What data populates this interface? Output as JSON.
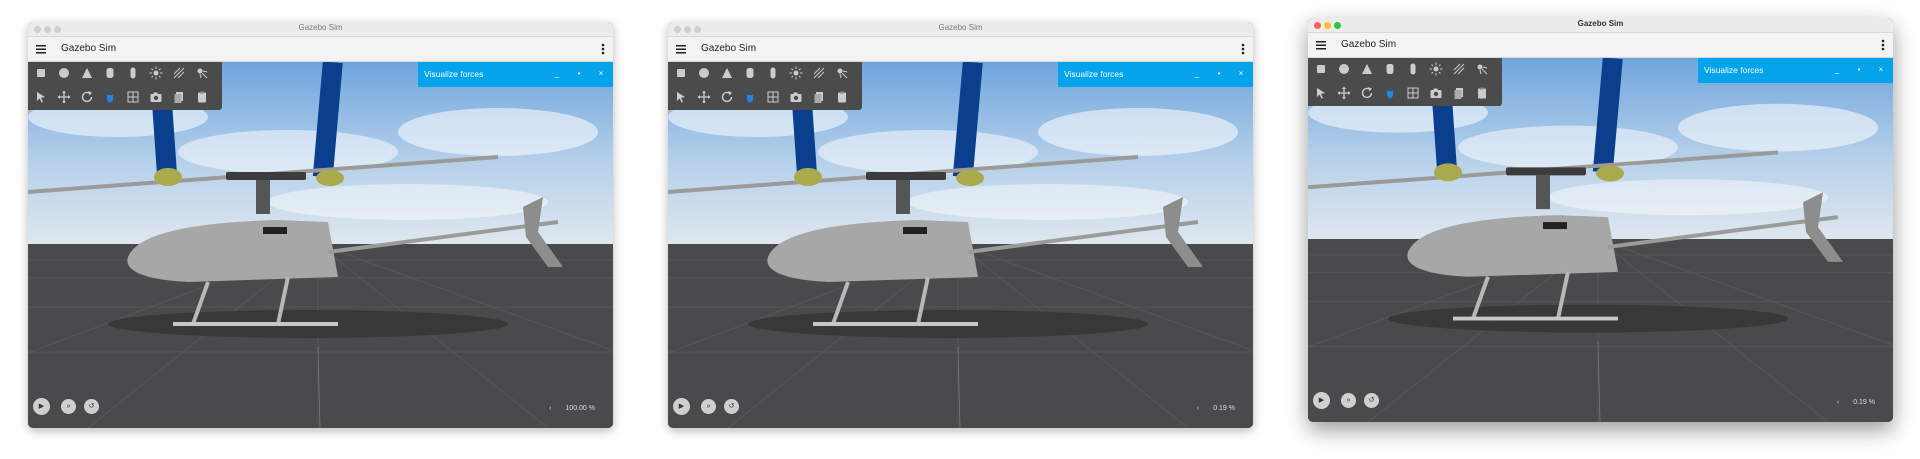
{
  "windows": [
    {
      "title": "Gazebo Sim",
      "app_name": "Gazebo Sim",
      "plugin_title": "Visualize forces",
      "rtf_arrow": "‹",
      "rtf": "100.00 %",
      "active": false
    },
    {
      "title": "Gazebo Sim",
      "app_name": "Gazebo Sim",
      "plugin_title": "Visualize forces",
      "rtf_arrow": "‹",
      "rtf": "0.19 %",
      "active": false
    },
    {
      "title": "Gazebo Sim",
      "app_name": "Gazebo Sim",
      "plugin_title": "Visualize forces",
      "rtf_arrow": "‹",
      "rtf": "0.19 %",
      "active": true
    }
  ],
  "plugin_buttons": {
    "minimize": "_",
    "pin": "•",
    "close": "×"
  },
  "controls": {
    "play": "▶",
    "step": "»",
    "reset": "↺"
  },
  "colors": {
    "plugin_header": "#04a3ec",
    "toolbar": "#4b4b4b",
    "ground": "#4a4a4c",
    "force_arrow": "#0b3f8e",
    "force_marker": "#a8aa4c",
    "helicopter_body": "#a7a7a7"
  },
  "icons": {
    "row1": [
      "box-icon",
      "sphere-icon",
      "cone-icon",
      "cylinder-icon",
      "capsule-icon",
      "sun-icon",
      "directional-light-icon",
      "spot-light-icon"
    ],
    "row2": [
      "select-icon",
      "translate-icon",
      "rotate-icon",
      "snap-icon",
      "grid-icon",
      "camera-icon",
      "copy-icon",
      "paste-icon"
    ]
  }
}
